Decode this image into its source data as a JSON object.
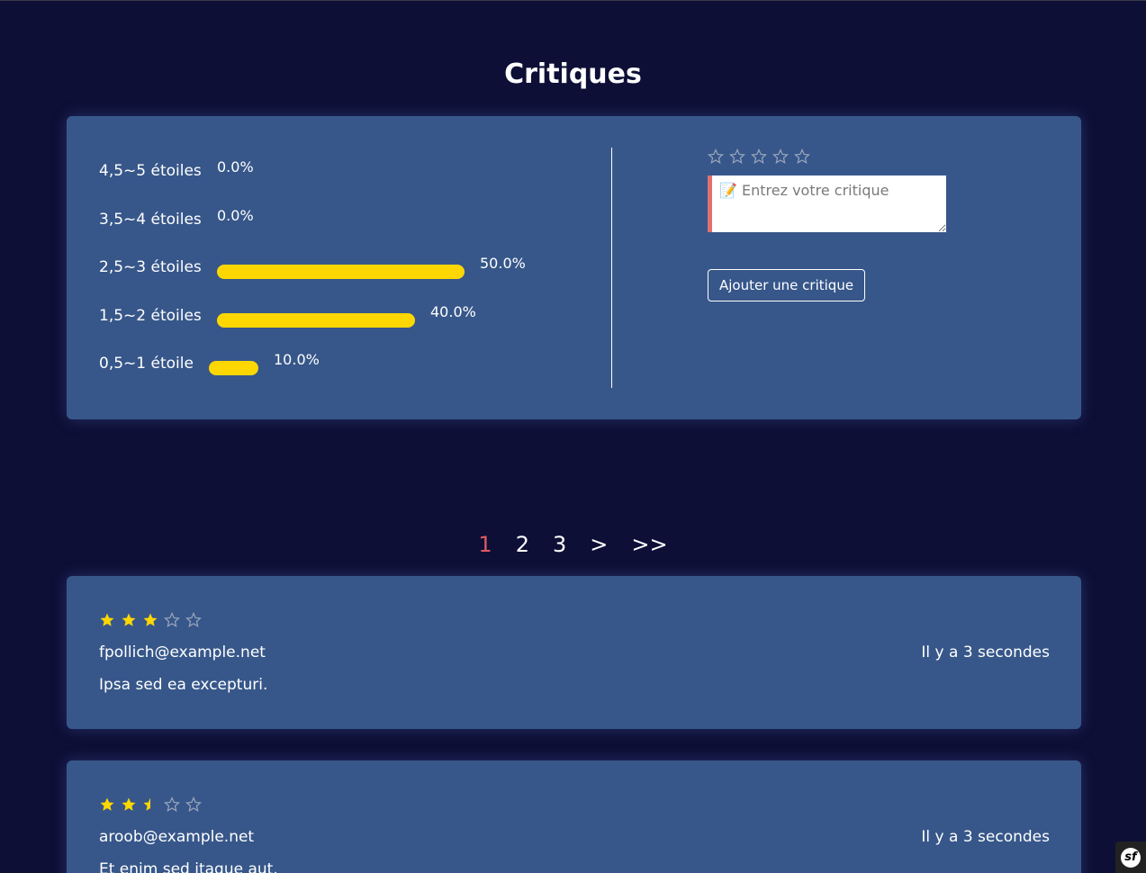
{
  "page": {
    "title": "Critiques"
  },
  "summary": {
    "rows": [
      {
        "label": "4,5~5 étoiles",
        "percent_text": "0.0%",
        "value": 0.0
      },
      {
        "label": "3,5~4 étoiles",
        "percent_text": "0.0%",
        "value": 0.0
      },
      {
        "label": "2,5~3 étoiles",
        "percent_text": "50.0%",
        "value": 50.0
      },
      {
        "label": "1,5~2 étoiles",
        "percent_text": "40.0%",
        "value": 40.0
      },
      {
        "label": "0,5~1 étoile",
        "percent_text": "10.0%",
        "value": 10.0
      }
    ]
  },
  "form": {
    "rating_value": 0,
    "rating_max": 5,
    "textarea_placeholder": "📝 Entrez votre critique",
    "submit_label": "Ajouter une critique"
  },
  "pagination": {
    "pages": [
      "1",
      "2",
      "3"
    ],
    "current": "1",
    "next_label": ">",
    "last_label": ">>"
  },
  "reviews": [
    {
      "rating": 3,
      "author": "fpollich@example.net",
      "time": "Il y a 3 secondes",
      "comment": "Ipsa sed ea excepturi."
    },
    {
      "rating": 2.5,
      "author": "aroob@example.net",
      "time": "Il y a 3 secondes",
      "comment": "Et enim sed itaque aut."
    }
  ],
  "colors": {
    "background": "#0d0f36",
    "card": "#37578a",
    "bar": "#ffd700",
    "star_filled": "#ffd700",
    "star_empty": "#9aa6bd",
    "pagination_active": "#e05a62",
    "textarea_accent": "#e07070"
  },
  "icons": {
    "star_full": "star-icon",
    "star_half": "star-half-icon",
    "star_empty": "star-outline-icon",
    "badge": "symfony-icon"
  },
  "badge": {
    "text": "sf"
  }
}
